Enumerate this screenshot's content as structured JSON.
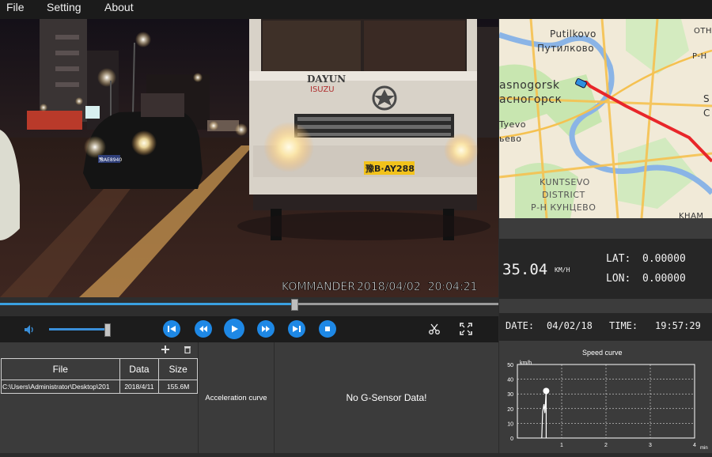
{
  "menu": {
    "file": "File",
    "setting": "Setting",
    "about": "About"
  },
  "video": {
    "overlay_text": "KOMMANDER",
    "overlay_datetime": "2018/04/02  20:04:21",
    "truck_brand": "DAYUN",
    "truck_sub": "ISUZU",
    "plate_truck": "豫B·AY288",
    "plate_car": "豫AE8940"
  },
  "playback": {
    "progress_fraction": 0.59,
    "volume_fraction": 0.95
  },
  "file_panel": {
    "columns": [
      "File",
      "Data",
      "Size"
    ],
    "rows": [
      {
        "file": "C:\\Users\\Administrator\\Desktop\\201",
        "date": "2018/4/11",
        "size": "155.6M"
      }
    ],
    "add_icon": "plus-icon",
    "delete_icon": "trash-icon"
  },
  "acceleration_label": "Acceleration curve",
  "gsensor_message": "No G-Sensor Data!",
  "map": {
    "labels": {
      "putilkovo_en": "Putilkovo",
      "putilkovo_ru": "Путилково",
      "krasnogorsk_en": "asnogorsk",
      "krasnogorsk_ru": "асногорск",
      "tyevo_en": "Tyevo",
      "tyevo_ru": "ьево",
      "kuntsevo1": "KUNTSEVO",
      "kuntsevo2": "DISTRICT",
      "kuntsevo_ru": "Р-Н КУНЦЕВО",
      "top_right1": "OTH",
      "top_right2": "Р-Н",
      "right1": "S",
      "right2": "C",
      "bottom_right": "KHAM"
    },
    "route_color": "#e8262a"
  },
  "gps": {
    "speed": "35.04",
    "speed_unit": "KM/H",
    "lat_label": "LAT:",
    "lat": "0.00000",
    "lon_label": "LON:",
    "lon": "0.00000"
  },
  "datetime": {
    "date_label": "DATE:",
    "date": "04/02/18",
    "time_label": "TIME:",
    "time": "19:57:29"
  },
  "speed_curve": {
    "title": "Speed curve",
    "y_unit": "km/h",
    "x_unit": "min",
    "y_ticks": [
      "0",
      "10",
      "20",
      "30",
      "40",
      "50"
    ],
    "x_ticks": [
      "1",
      "2",
      "3",
      "4"
    ],
    "current_speed": 32,
    "current_time_min": 0.65
  },
  "colors": {
    "accent": "#1e88e5",
    "route": "#e8262a",
    "panel": "#3b3b3b",
    "dark": "#1c1c1c"
  },
  "icons": {
    "volume": "speaker-icon",
    "prev": "skip-previous-icon",
    "rewind": "rewind-icon",
    "play": "play-icon",
    "forward": "fast-forward-icon",
    "next": "skip-next-icon",
    "stop": "stop-icon",
    "scissors": "scissors-icon",
    "fullscreen": "fullscreen-icon"
  }
}
